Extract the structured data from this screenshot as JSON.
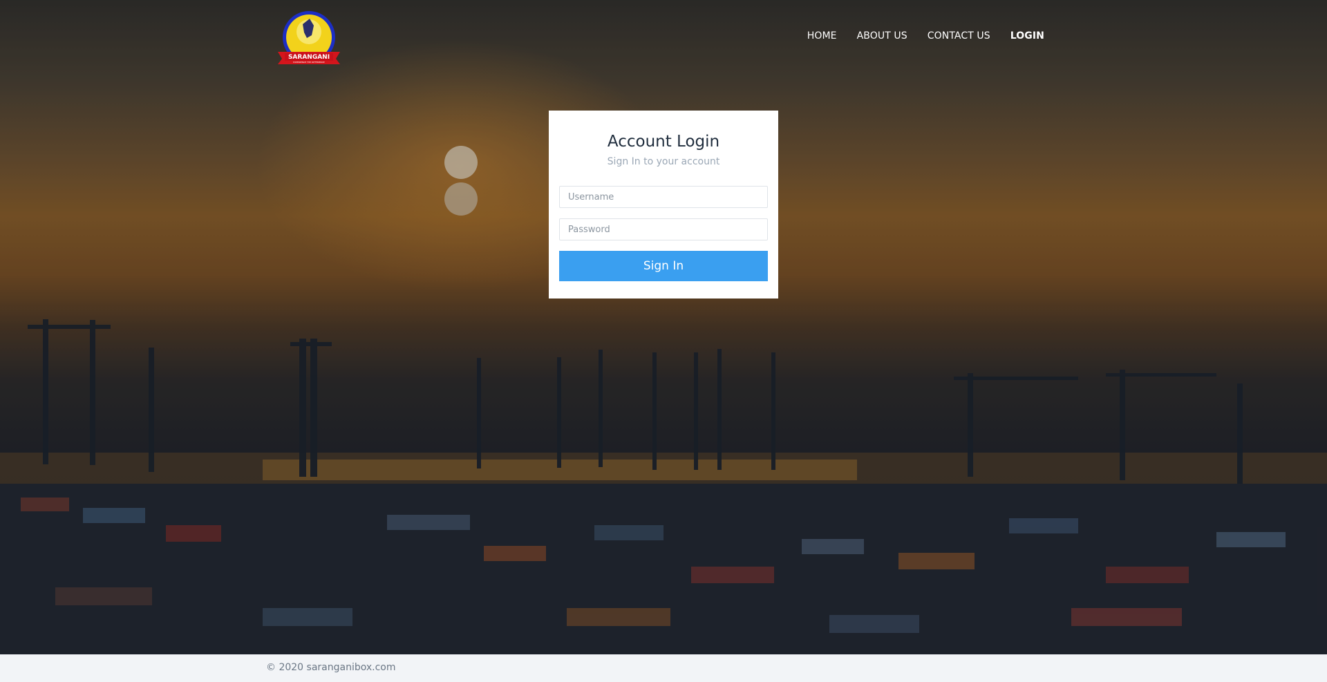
{
  "brand": {
    "logo_text": "SARANGANI",
    "logo_tagline": "EXPERIENCE THE DIFFERENCE"
  },
  "nav": {
    "items": [
      {
        "label": "HOME",
        "active": false
      },
      {
        "label": "ABOUT US",
        "active": false
      },
      {
        "label": "CONTACT US",
        "active": false
      },
      {
        "label": "LOGIN",
        "active": true
      }
    ]
  },
  "login": {
    "title": "Account Login",
    "subtitle": "Sign In to your account",
    "username_placeholder": "Username",
    "password_placeholder": "Password",
    "submit_label": "Sign In"
  },
  "footer": {
    "copyright": "© 2020 saranganibox.com"
  },
  "colors": {
    "button": "#3a9ff0",
    "footer_bg": "#f2f4f7",
    "card_bg": "#ffffff"
  }
}
